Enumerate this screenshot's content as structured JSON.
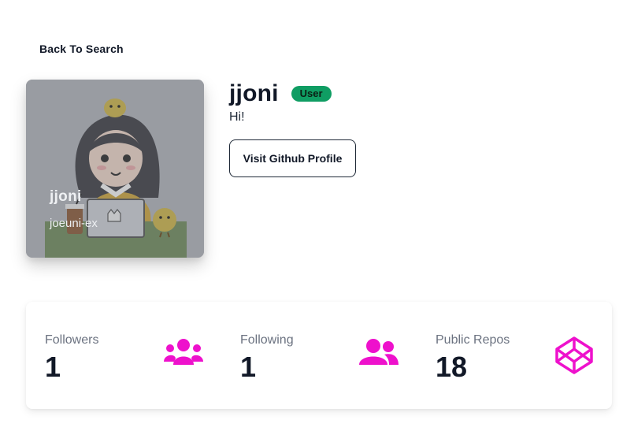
{
  "nav": {
    "back_label": "Back To Search"
  },
  "profile_card": {
    "name": "jjoni",
    "login": "joeuni-ex"
  },
  "user": {
    "username": "jjoni",
    "badge": "User",
    "bio": "Hi!",
    "visit_label": "Visit Github Profile"
  },
  "stats": [
    {
      "label": "Followers",
      "value": "1",
      "icon": "users-group-icon"
    },
    {
      "label": "Following",
      "value": "1",
      "icon": "user-friends-icon"
    },
    {
      "label": "Public Repos",
      "value": "18",
      "icon": "codepen-icon"
    }
  ],
  "colors": {
    "icon_accent": "#ee11cc",
    "badge_bg": "#0f9d63"
  }
}
